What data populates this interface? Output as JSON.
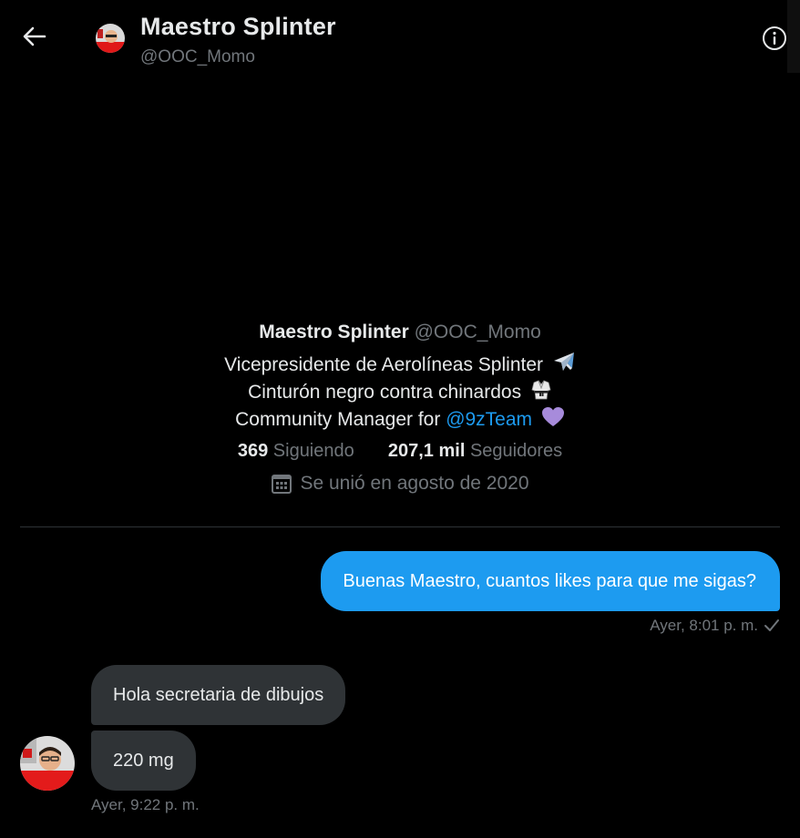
{
  "header": {
    "name": "Maestro Splinter",
    "handle": "@OOC_Momo"
  },
  "profile": {
    "name": "Maestro Splinter",
    "handle": "@OOC_Momo",
    "bio_line1": "Vicepresidente de Aerolíneas Splinter",
    "bio_line1_emoji": "airplane-emoji",
    "bio_line2": "Cinturón negro contra chinardos",
    "bio_line2_emoji": "martial-arts-uniform-emoji",
    "bio_line3_prefix": "Community Manager for",
    "bio_line3_mention": "@9zTeam",
    "bio_line3_emoji": "purple-heart-emoji",
    "following_count": "369",
    "following_label": "Siguiendo",
    "followers_count": "207,1 mil",
    "followers_label": "Seguidores",
    "joined": "Se unió en agosto de 2020"
  },
  "messages": [
    {
      "direction": "outgoing",
      "text": "Buenas Maestro, cuantos likes para que me sigas?",
      "time": "Ayer, 8:01 p. m."
    },
    {
      "direction": "incoming",
      "text": "Hola secretaria de dibujos"
    },
    {
      "direction": "incoming",
      "text": "220 mg",
      "time": "Ayer, 9:22 p. m."
    }
  ],
  "colors": {
    "background": "#000000",
    "accent": "#1d9bf0",
    "incoming_bubble": "#2f3336",
    "muted_text": "#71767b",
    "primary_text": "#e7e9ea",
    "heart": "#a78bdb"
  }
}
